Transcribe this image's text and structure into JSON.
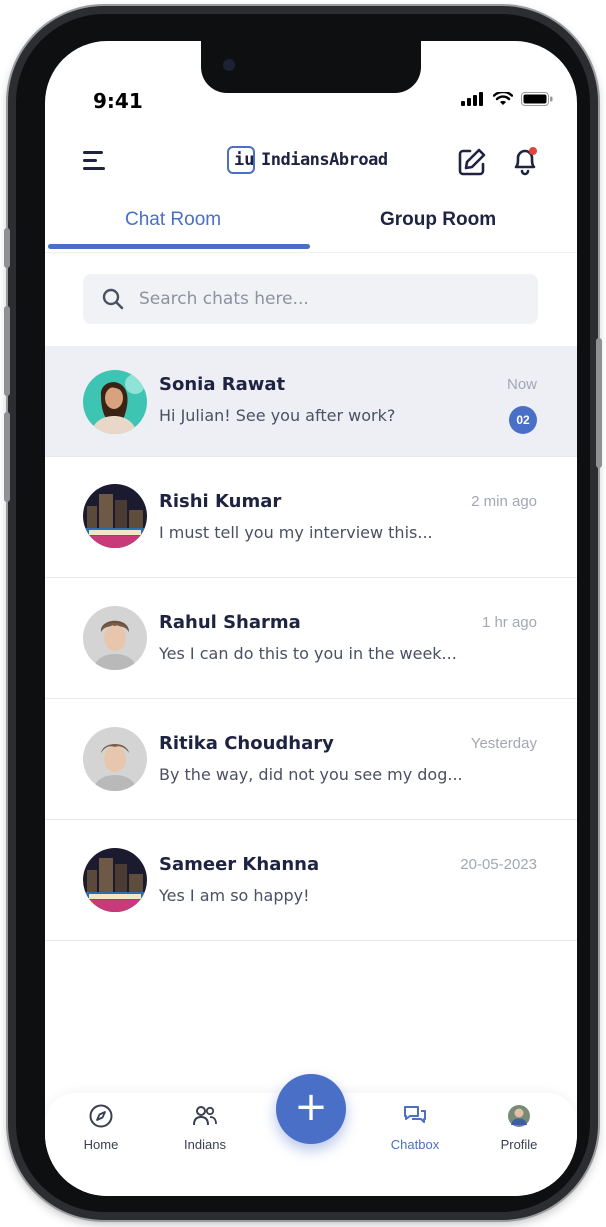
{
  "status_bar": {
    "time": "9:41"
  },
  "app": {
    "name": "IndiansAbroad",
    "logo_glyph": "iu"
  },
  "tabs": [
    {
      "label": "Chat Room",
      "active": true
    },
    {
      "label": "Group Room",
      "active": false
    }
  ],
  "search": {
    "placeholder": "Search chats here...",
    "value": ""
  },
  "chats": [
    {
      "name": "Sonia Rawat",
      "message": "Hi Julian! See you after work?",
      "time": "Now",
      "unread": "02",
      "avatar": "woman-portrait"
    },
    {
      "name": "Rishi Kumar",
      "message": "I must tell you my interview this...",
      "time": "2 min ago",
      "avatar": "toronto-city"
    },
    {
      "name": "Rahul Sharma",
      "message": "Yes I can do this to you in the week...",
      "time": "1 hr ago",
      "avatar": "young-man-portrait"
    },
    {
      "name": "Ritika Choudhary",
      "message": "By the way, did not you see my dog...",
      "time": "Yesterday",
      "avatar": "young-man-portrait"
    },
    {
      "name": "Sameer Khanna",
      "message": "Yes I am so happy!",
      "time": "20-05-2023",
      "avatar": "toronto-city"
    }
  ],
  "bottom_nav": [
    {
      "label": "Home",
      "icon": "compass-icon",
      "active": false
    },
    {
      "label": "Indians",
      "icon": "people-icon",
      "active": false
    },
    {
      "label": "Chatbox",
      "icon": "chat-bubbles-icon",
      "active": true
    },
    {
      "label": "Profile",
      "icon": "profile-avatar-icon",
      "active": false
    }
  ],
  "fab": {
    "label": "+"
  },
  "colors": {
    "accent": "#4a6fc7",
    "text": "#1d2340",
    "notification_dot": "#e0453a"
  }
}
